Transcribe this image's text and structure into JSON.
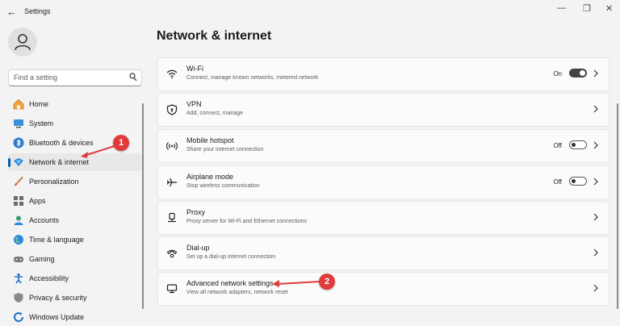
{
  "window": {
    "title": "Settings"
  },
  "search": {
    "placeholder": "Find a setting"
  },
  "sidebar": {
    "items": [
      {
        "label": "Home",
        "icon": "home-icon"
      },
      {
        "label": "System",
        "icon": "monitor-icon"
      },
      {
        "label": "Bluetooth & devices",
        "icon": "bluetooth-icon"
      },
      {
        "label": "Network & internet",
        "icon": "wifi-diamond-icon",
        "active": true
      },
      {
        "label": "Personalization",
        "icon": "brush-icon"
      },
      {
        "label": "Apps",
        "icon": "apps-icon"
      },
      {
        "label": "Accounts",
        "icon": "accounts-icon"
      },
      {
        "label": "Time & language",
        "icon": "globe-icon"
      },
      {
        "label": "Gaming",
        "icon": "gamepad-icon"
      },
      {
        "label": "Accessibility",
        "icon": "accessibility-icon"
      },
      {
        "label": "Privacy & security",
        "icon": "shield-icon"
      },
      {
        "label": "Windows Update",
        "icon": "update-icon"
      }
    ]
  },
  "main": {
    "title": "Network & internet",
    "cards": [
      {
        "title": "Wi-Fi",
        "subtitle": "Connect, manage known networks, metered network",
        "icon": "wifi-icon",
        "toggle": "On",
        "toggle_on": true
      },
      {
        "title": "VPN",
        "subtitle": "Add, connect, manage",
        "icon": "vpn-shield-icon"
      },
      {
        "title": "Mobile hotspot",
        "subtitle": "Share your internet connection",
        "icon": "hotspot-icon",
        "toggle": "Off",
        "toggle_on": false
      },
      {
        "title": "Airplane mode",
        "subtitle": "Stop wireless communication",
        "icon": "airplane-icon",
        "toggle": "Off",
        "toggle_on": false
      },
      {
        "title": "Proxy",
        "subtitle": "Proxy server for Wi-Fi and Ethernet connections",
        "icon": "proxy-icon"
      },
      {
        "title": "Dial-up",
        "subtitle": "Set up a dial-up internet connection",
        "icon": "dialup-icon"
      },
      {
        "title": "Advanced network settings",
        "subtitle": "View all network adapters, network reset",
        "icon": "network-adapter-icon"
      }
    ]
  },
  "annotations": [
    {
      "number": "1",
      "color": "#e03b3b"
    },
    {
      "number": "2",
      "color": "#e03b3b"
    }
  ],
  "colors": {
    "accent": "#005fb8",
    "background": "#f3f3f3",
    "card": "#fbfbfb"
  }
}
